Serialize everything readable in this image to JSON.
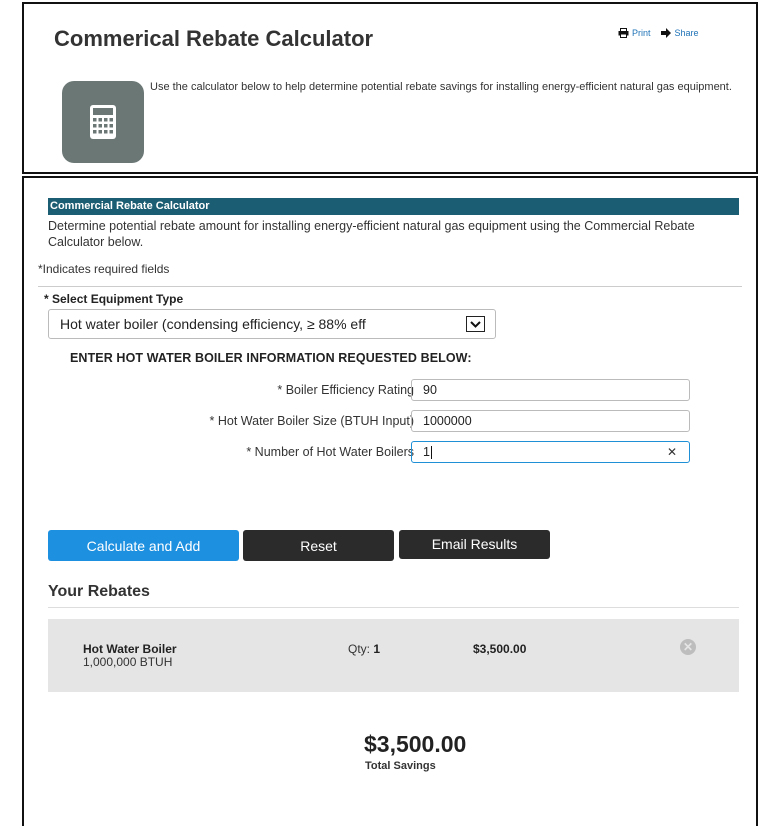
{
  "header": {
    "title": "Commerical Rebate Calculator",
    "print_label": "Print",
    "share_label": "Share",
    "intro": "Use the calculator below to help determine potential rebate savings for installing energy-efficient natural gas equipment."
  },
  "calculator": {
    "header": "Commercial Rebate Calculator",
    "description": "Determine potential rebate amount for installing energy-efficient natural gas equipment using the Commercial Rebate Calculator below.",
    "required_note": "*Indicates required fields",
    "equipment_label": "* Select Equipment Type",
    "equipment_selected": "Hot water boiler (condensing efficiency, ≥ 88% eff",
    "section_heading": "ENTER HOT WATER BOILER INFORMATION REQUESTED BELOW:",
    "fields": [
      {
        "label": "* Boiler Efficiency Rating",
        "value": "90"
      },
      {
        "label": "* Hot Water Boiler Size (BTUH Input)",
        "value": "1000000"
      },
      {
        "label": "* Number of Hot Water Boilers",
        "value": "1"
      }
    ],
    "buttons": {
      "calculate": "Calculate and Add",
      "reset": "Reset",
      "email": "Email Results"
    }
  },
  "rebates": {
    "title": "Your Rebates",
    "items": [
      {
        "name": "Hot Water Boiler",
        "detail": "1,000,000 BTUH",
        "qty_label": "Qty:",
        "qty": "1",
        "amount": "$3,500.00"
      }
    ],
    "total_amount": "$3,500.00",
    "total_label": "Total Savings"
  },
  "colors": {
    "accent_blue": "#1e90e0",
    "header_teal": "#1b5d72",
    "button_dark": "#2b2b2b"
  }
}
